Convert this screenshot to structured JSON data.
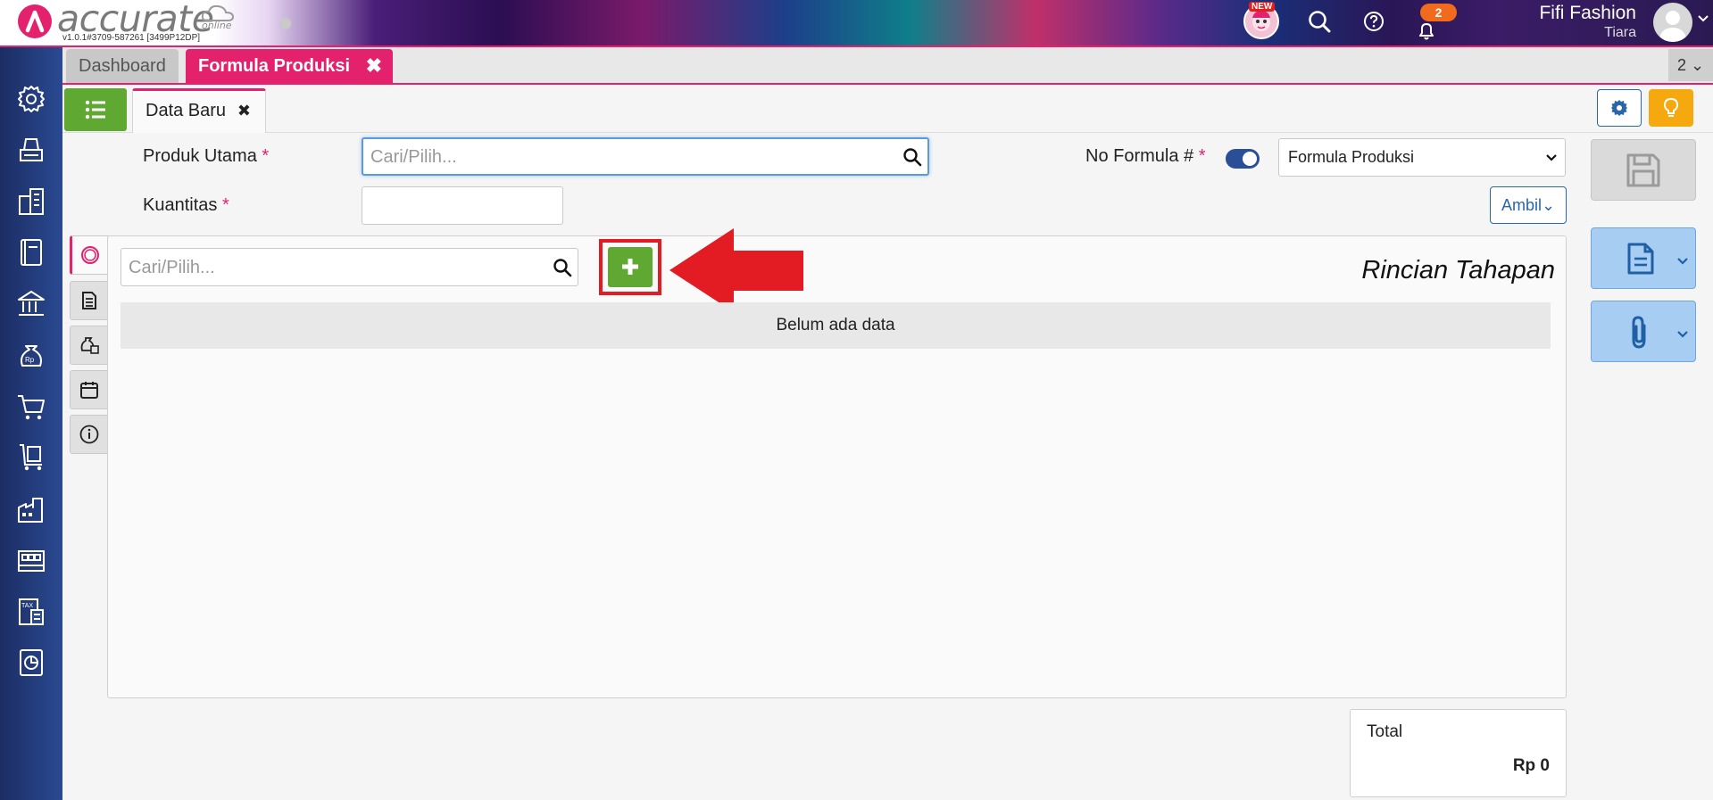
{
  "app": {
    "logo_text": "accurate",
    "logo_sub": "online",
    "version": "v1.0.1#3709-587261 [3499P12DP]",
    "new_badge": "NEW",
    "notification_count": "2",
    "user_company": "Fifi Fashion",
    "user_name": "Tiara",
    "brand_color": "#e4216c"
  },
  "tabs": [
    {
      "label": "Dashboard"
    },
    {
      "label": "Formula Produksi"
    }
  ],
  "tab_count": "2",
  "subtab": {
    "label": "Data Baru"
  },
  "form": {
    "produk_label": "Produk Utama",
    "produk_placeholder": "Cari/Pilih...",
    "kuantitas_label": "Kuantitas",
    "kuantitas_value": "",
    "no_formula_label": "No Formula #",
    "required_mark": "*",
    "formula_select": "Formula Produksi",
    "ambil_label": "Ambil"
  },
  "detail": {
    "search_placeholder": "Cari/Pilih...",
    "title": "Rincian Tahapan",
    "empty_text": "Belum ada data"
  },
  "total": {
    "label": "Total",
    "value": "Rp 0"
  },
  "icons": {
    "sidebar": [
      "gear-icon",
      "printer-icon",
      "building-icon",
      "book-icon",
      "bank-icon",
      "money-bag-icon",
      "cart-icon",
      "trolley-icon",
      "factory-icon",
      "warehouse-icon",
      "tax-icon",
      "report-icon"
    ],
    "vertical_tabs": [
      "stages-icon",
      "document-icon",
      "cost-icon",
      "calendar-icon",
      "info-icon"
    ]
  }
}
